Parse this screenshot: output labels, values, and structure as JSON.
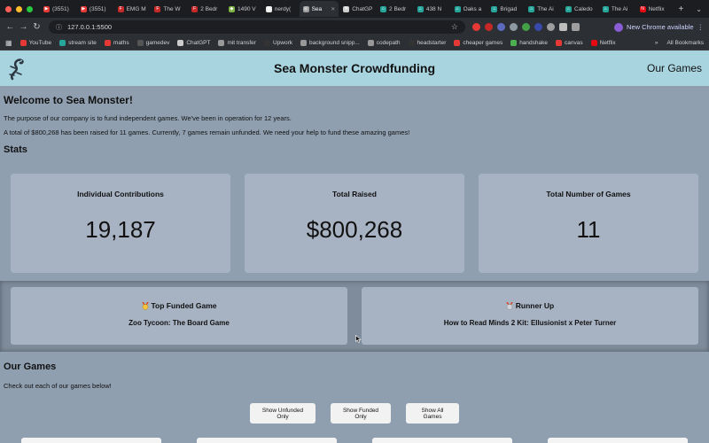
{
  "browser": {
    "tabs": [
      {
        "title": "(3551)",
        "color": "#e53935",
        "glyph": "▶"
      },
      {
        "title": "(3551)",
        "color": "#e53935",
        "glyph": "▶"
      },
      {
        "title": "EMG M",
        "color": "#c62828",
        "glyph": "F"
      },
      {
        "title": "The W",
        "color": "#c62828",
        "glyph": "F"
      },
      {
        "title": "2 Bedr",
        "color": "#c62828",
        "glyph": "F"
      },
      {
        "title": "1490 V",
        "color": "#7cb342",
        "glyph": "◆"
      },
      {
        "title": "nerdy(",
        "color": "#eeeeee",
        "glyph": "◉"
      },
      {
        "title": "Sea",
        "color": "#9e9e9e",
        "glyph": "◎"
      },
      {
        "title": "ChatGP",
        "color": "#cfcfcf",
        "glyph": "✲"
      },
      {
        "title": "2 Bedr",
        "color": "#26a69a",
        "glyph": "⌂"
      },
      {
        "title": "438 N",
        "color": "#26a69a",
        "glyph": "⌂"
      },
      {
        "title": "Oaks a",
        "color": "#26a69a",
        "glyph": "⌂"
      },
      {
        "title": "Brigad",
        "color": "#26a69a",
        "glyph": "⌂"
      },
      {
        "title": "The Ai",
        "color": "#26a69a",
        "glyph": "⌂"
      },
      {
        "title": "Caledo",
        "color": "#26a69a",
        "glyph": "⌂"
      },
      {
        "title": "The Ai",
        "color": "#26a69a",
        "glyph": "⌂"
      },
      {
        "title": "Netflix",
        "color": "#e50914",
        "glyph": "N"
      }
    ],
    "url": "127.0.0.1:5500",
    "update_label": "New Chrome available",
    "bookmarks": [
      {
        "label": "YouTube",
        "color": "#e53935"
      },
      {
        "label": "stream site",
        "color": "#26a69a"
      },
      {
        "label": "maths",
        "color": "#e53935"
      },
      {
        "label": "gamedev",
        "color": "#555555"
      },
      {
        "label": "ChatGPT",
        "color": "#cccccc"
      },
      {
        "label": "mit transfer",
        "color": "#999999"
      },
      {
        "label": "Upwork",
        "color": "#333333"
      },
      {
        "label": "background snipp...",
        "color": "#999999"
      },
      {
        "label": "codepath",
        "color": "#999999"
      },
      {
        "label": "headstarter",
        "color": "#333333"
      },
      {
        "label": "cheaper games",
        "color": "#e53935"
      },
      {
        "label": "handshake",
        "color": "#4caf50"
      },
      {
        "label": "canvas",
        "color": "#e53935"
      },
      {
        "label": "Netflix",
        "color": "#e50914"
      }
    ],
    "all_bookmarks_label": "All Bookmarks"
  },
  "site": {
    "title": "Sea Monster Crowdfunding",
    "nav_link": "Our Games"
  },
  "intro": {
    "heading": "Welcome to Sea Monster!",
    "paragraph1": "The purpose of our company is to fund independent games. We've been in operation for 12 years.",
    "paragraph2": "A total of $800,268 has been raised for 11 games. Currently, 7 games remain unfunded. We need your help to fund these amazing games!"
  },
  "stats": {
    "heading": "Stats",
    "cards": [
      {
        "label": "Individual Contributions",
        "value": "19,187"
      },
      {
        "label": "Total Raised",
        "value": "$800,268"
      },
      {
        "label": "Total Number of Games",
        "value": "11"
      }
    ]
  },
  "funded": {
    "top": {
      "title": "Top Funded Game",
      "name": "Zoo Tycoon: The Board Game"
    },
    "runner_up": {
      "title": "Runner Up",
      "name": "How to Read Minds 2 Kit: Ellusionist x Peter Turner"
    }
  },
  "games": {
    "heading": "Our Games",
    "subtitle": "Check out each of our games below!",
    "buttons": {
      "unfunded": "Show Unfunded Only",
      "funded": "Show Funded Only",
      "all": "Show All Games"
    }
  }
}
